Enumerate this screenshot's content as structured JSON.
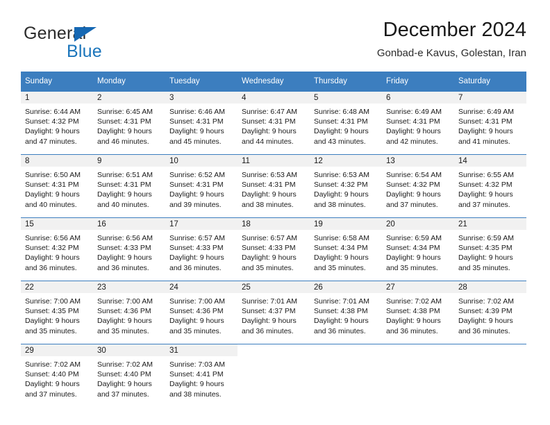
{
  "logo": {
    "word_one": "General",
    "word_two": "Blue",
    "triangle_color": "#1668b3",
    "blue_color": "#1b75bb"
  },
  "header": {
    "title": "December 2024",
    "subtitle": "Gonbad-e Kavus, Golestan, Iran"
  },
  "theme": {
    "header_blue": "#3c7ebf",
    "daynum_band": "#f1f1f1",
    "text": "#1a1a1a"
  },
  "calendar": {
    "weekday_headers": [
      "Sunday",
      "Monday",
      "Tuesday",
      "Wednesday",
      "Thursday",
      "Friday",
      "Saturday"
    ],
    "weeks": [
      [
        {
          "day": "1",
          "sunrise": "Sunrise: 6:44 AM",
          "sunset": "Sunset: 4:32 PM",
          "daylight_1": "Daylight: 9 hours",
          "daylight_2": "and 47 minutes."
        },
        {
          "day": "2",
          "sunrise": "Sunrise: 6:45 AM",
          "sunset": "Sunset: 4:31 PM",
          "daylight_1": "Daylight: 9 hours",
          "daylight_2": "and 46 minutes."
        },
        {
          "day": "3",
          "sunrise": "Sunrise: 6:46 AM",
          "sunset": "Sunset: 4:31 PM",
          "daylight_1": "Daylight: 9 hours",
          "daylight_2": "and 45 minutes."
        },
        {
          "day": "4",
          "sunrise": "Sunrise: 6:47 AM",
          "sunset": "Sunset: 4:31 PM",
          "daylight_1": "Daylight: 9 hours",
          "daylight_2": "and 44 minutes."
        },
        {
          "day": "5",
          "sunrise": "Sunrise: 6:48 AM",
          "sunset": "Sunset: 4:31 PM",
          "daylight_1": "Daylight: 9 hours",
          "daylight_2": "and 43 minutes."
        },
        {
          "day": "6",
          "sunrise": "Sunrise: 6:49 AM",
          "sunset": "Sunset: 4:31 PM",
          "daylight_1": "Daylight: 9 hours",
          "daylight_2": "and 42 minutes."
        },
        {
          "day": "7",
          "sunrise": "Sunrise: 6:49 AM",
          "sunset": "Sunset: 4:31 PM",
          "daylight_1": "Daylight: 9 hours",
          "daylight_2": "and 41 minutes."
        }
      ],
      [
        {
          "day": "8",
          "sunrise": "Sunrise: 6:50 AM",
          "sunset": "Sunset: 4:31 PM",
          "daylight_1": "Daylight: 9 hours",
          "daylight_2": "and 40 minutes."
        },
        {
          "day": "9",
          "sunrise": "Sunrise: 6:51 AM",
          "sunset": "Sunset: 4:31 PM",
          "daylight_1": "Daylight: 9 hours",
          "daylight_2": "and 40 minutes."
        },
        {
          "day": "10",
          "sunrise": "Sunrise: 6:52 AM",
          "sunset": "Sunset: 4:31 PM",
          "daylight_1": "Daylight: 9 hours",
          "daylight_2": "and 39 minutes."
        },
        {
          "day": "11",
          "sunrise": "Sunrise: 6:53 AM",
          "sunset": "Sunset: 4:31 PM",
          "daylight_1": "Daylight: 9 hours",
          "daylight_2": "and 38 minutes."
        },
        {
          "day": "12",
          "sunrise": "Sunrise: 6:53 AM",
          "sunset": "Sunset: 4:32 PM",
          "daylight_1": "Daylight: 9 hours",
          "daylight_2": "and 38 minutes."
        },
        {
          "day": "13",
          "sunrise": "Sunrise: 6:54 AM",
          "sunset": "Sunset: 4:32 PM",
          "daylight_1": "Daylight: 9 hours",
          "daylight_2": "and 37 minutes."
        },
        {
          "day": "14",
          "sunrise": "Sunrise: 6:55 AM",
          "sunset": "Sunset: 4:32 PM",
          "daylight_1": "Daylight: 9 hours",
          "daylight_2": "and 37 minutes."
        }
      ],
      [
        {
          "day": "15",
          "sunrise": "Sunrise: 6:56 AM",
          "sunset": "Sunset: 4:32 PM",
          "daylight_1": "Daylight: 9 hours",
          "daylight_2": "and 36 minutes."
        },
        {
          "day": "16",
          "sunrise": "Sunrise: 6:56 AM",
          "sunset": "Sunset: 4:33 PM",
          "daylight_1": "Daylight: 9 hours",
          "daylight_2": "and 36 minutes."
        },
        {
          "day": "17",
          "sunrise": "Sunrise: 6:57 AM",
          "sunset": "Sunset: 4:33 PM",
          "daylight_1": "Daylight: 9 hours",
          "daylight_2": "and 36 minutes."
        },
        {
          "day": "18",
          "sunrise": "Sunrise: 6:57 AM",
          "sunset": "Sunset: 4:33 PM",
          "daylight_1": "Daylight: 9 hours",
          "daylight_2": "and 35 minutes."
        },
        {
          "day": "19",
          "sunrise": "Sunrise: 6:58 AM",
          "sunset": "Sunset: 4:34 PM",
          "daylight_1": "Daylight: 9 hours",
          "daylight_2": "and 35 minutes."
        },
        {
          "day": "20",
          "sunrise": "Sunrise: 6:59 AM",
          "sunset": "Sunset: 4:34 PM",
          "daylight_1": "Daylight: 9 hours",
          "daylight_2": "and 35 minutes."
        },
        {
          "day": "21",
          "sunrise": "Sunrise: 6:59 AM",
          "sunset": "Sunset: 4:35 PM",
          "daylight_1": "Daylight: 9 hours",
          "daylight_2": "and 35 minutes."
        }
      ],
      [
        {
          "day": "22",
          "sunrise": "Sunrise: 7:00 AM",
          "sunset": "Sunset: 4:35 PM",
          "daylight_1": "Daylight: 9 hours",
          "daylight_2": "and 35 minutes."
        },
        {
          "day": "23",
          "sunrise": "Sunrise: 7:00 AM",
          "sunset": "Sunset: 4:36 PM",
          "daylight_1": "Daylight: 9 hours",
          "daylight_2": "and 35 minutes."
        },
        {
          "day": "24",
          "sunrise": "Sunrise: 7:00 AM",
          "sunset": "Sunset: 4:36 PM",
          "daylight_1": "Daylight: 9 hours",
          "daylight_2": "and 35 minutes."
        },
        {
          "day": "25",
          "sunrise": "Sunrise: 7:01 AM",
          "sunset": "Sunset: 4:37 PM",
          "daylight_1": "Daylight: 9 hours",
          "daylight_2": "and 36 minutes."
        },
        {
          "day": "26",
          "sunrise": "Sunrise: 7:01 AM",
          "sunset": "Sunset: 4:38 PM",
          "daylight_1": "Daylight: 9 hours",
          "daylight_2": "and 36 minutes."
        },
        {
          "day": "27",
          "sunrise": "Sunrise: 7:02 AM",
          "sunset": "Sunset: 4:38 PM",
          "daylight_1": "Daylight: 9 hours",
          "daylight_2": "and 36 minutes."
        },
        {
          "day": "28",
          "sunrise": "Sunrise: 7:02 AM",
          "sunset": "Sunset: 4:39 PM",
          "daylight_1": "Daylight: 9 hours",
          "daylight_2": "and 36 minutes."
        }
      ],
      [
        {
          "day": "29",
          "sunrise": "Sunrise: 7:02 AM",
          "sunset": "Sunset: 4:40 PM",
          "daylight_1": "Daylight: 9 hours",
          "daylight_2": "and 37 minutes."
        },
        {
          "day": "30",
          "sunrise": "Sunrise: 7:02 AM",
          "sunset": "Sunset: 4:40 PM",
          "daylight_1": "Daylight: 9 hours",
          "daylight_2": "and 37 minutes."
        },
        {
          "day": "31",
          "sunrise": "Sunrise: 7:03 AM",
          "sunset": "Sunset: 4:41 PM",
          "daylight_1": "Daylight: 9 hours",
          "daylight_2": "and 38 minutes."
        },
        null,
        null,
        null,
        null
      ]
    ]
  }
}
